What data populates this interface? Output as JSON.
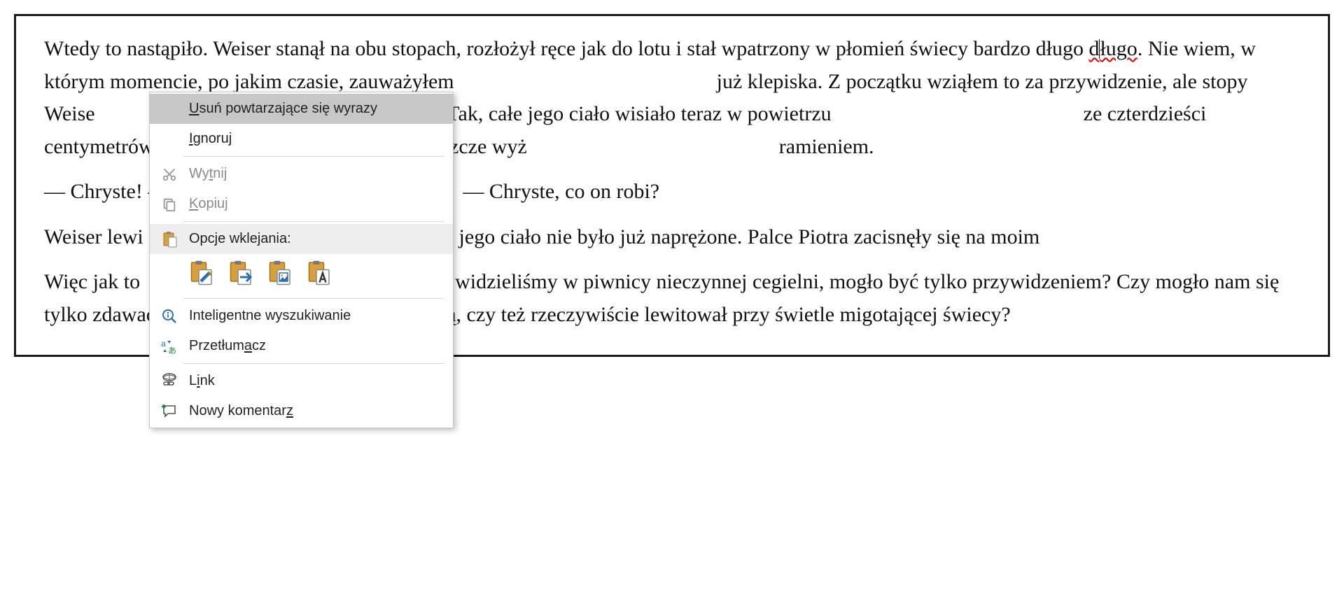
{
  "document": {
    "para1_a": "Wtedy to nastąpiło. Weiser stanął na obu stopach, rozłożył ręce jak do lotu i stał wpatrzony w płomień świecy bardzo długo ",
    "para1_err_pre": "d",
    "para1_err_post": "ługo",
    "para1_b": ". Nie wiem, w którym momencie, po jakim czasie, zauważyłem",
    "para1_c": "już klepiska. Z początku wziąłem to za przywidzenie, ale stopy Weise",
    "para1_d": "się nad podłogą. Tak, całe jego ciało wisiało teraz w powietrzu",
    "para1_e": "ze czterdzieści centymetrów nad ziemią i powoli unosiło się jeszcze wyż",
    "para1_f": "ramieniem.",
    "para2_a": "— Chryste! —",
    "para2_b": "— Chryste, co on robi?",
    "para3_a": "Weiser lewi",
    "para3_b": "i jego ciało nie było już naprężone. Palce Piotra zacisnęły się na moim",
    "para4_a": "Więc jak to",
    "para4_b": "widzieliśmy w piwnicy nieczynnej cegielni, mogło być tylko przywidzeniem? Czy mogło nam się tylko zdawać, że Weiser unosi się ponad podłogą, czy też rzeczywiście lewitował przy świetle migotającej świecy?"
  },
  "contextmenu": {
    "delete_repeated": {
      "pre": "",
      "u": "U",
      "post": "suń powtarzające się wyrazy"
    },
    "ignore": {
      "pre": "",
      "u": "I",
      "post": "gnoruj"
    },
    "cut": {
      "pre": "Wy",
      "u": "t",
      "post": "nij"
    },
    "copy": {
      "pre": "",
      "u": "K",
      "post": "opiuj"
    },
    "paste_section": "Opcje wklejania:",
    "smart_lookup": "Inteligentne wyszukiwanie",
    "translate": {
      "pre": "Przetłum",
      "u": "a",
      "post": "cz"
    },
    "link": {
      "pre": "L",
      "u": "i",
      "post": "nk"
    },
    "new_comment": {
      "pre": "Nowy komentar",
      "u": "z",
      "post": ""
    }
  },
  "icons": {
    "scissors": "scissors-icon",
    "copy": "copy-icon",
    "paste": "paste-icon",
    "paste_source": "paste-keep-source-icon",
    "paste_merge": "paste-merge-icon",
    "paste_picture": "paste-picture-icon",
    "paste_text": "paste-text-only-icon",
    "lookup": "magnifier-info-icon",
    "translate": "translate-icon",
    "link": "link-icon",
    "comment": "comment-add-icon"
  },
  "colors": {
    "menu_border": "#c8c8c8",
    "selected_bg": "#c7c7c7",
    "error_underline": "#d00"
  }
}
